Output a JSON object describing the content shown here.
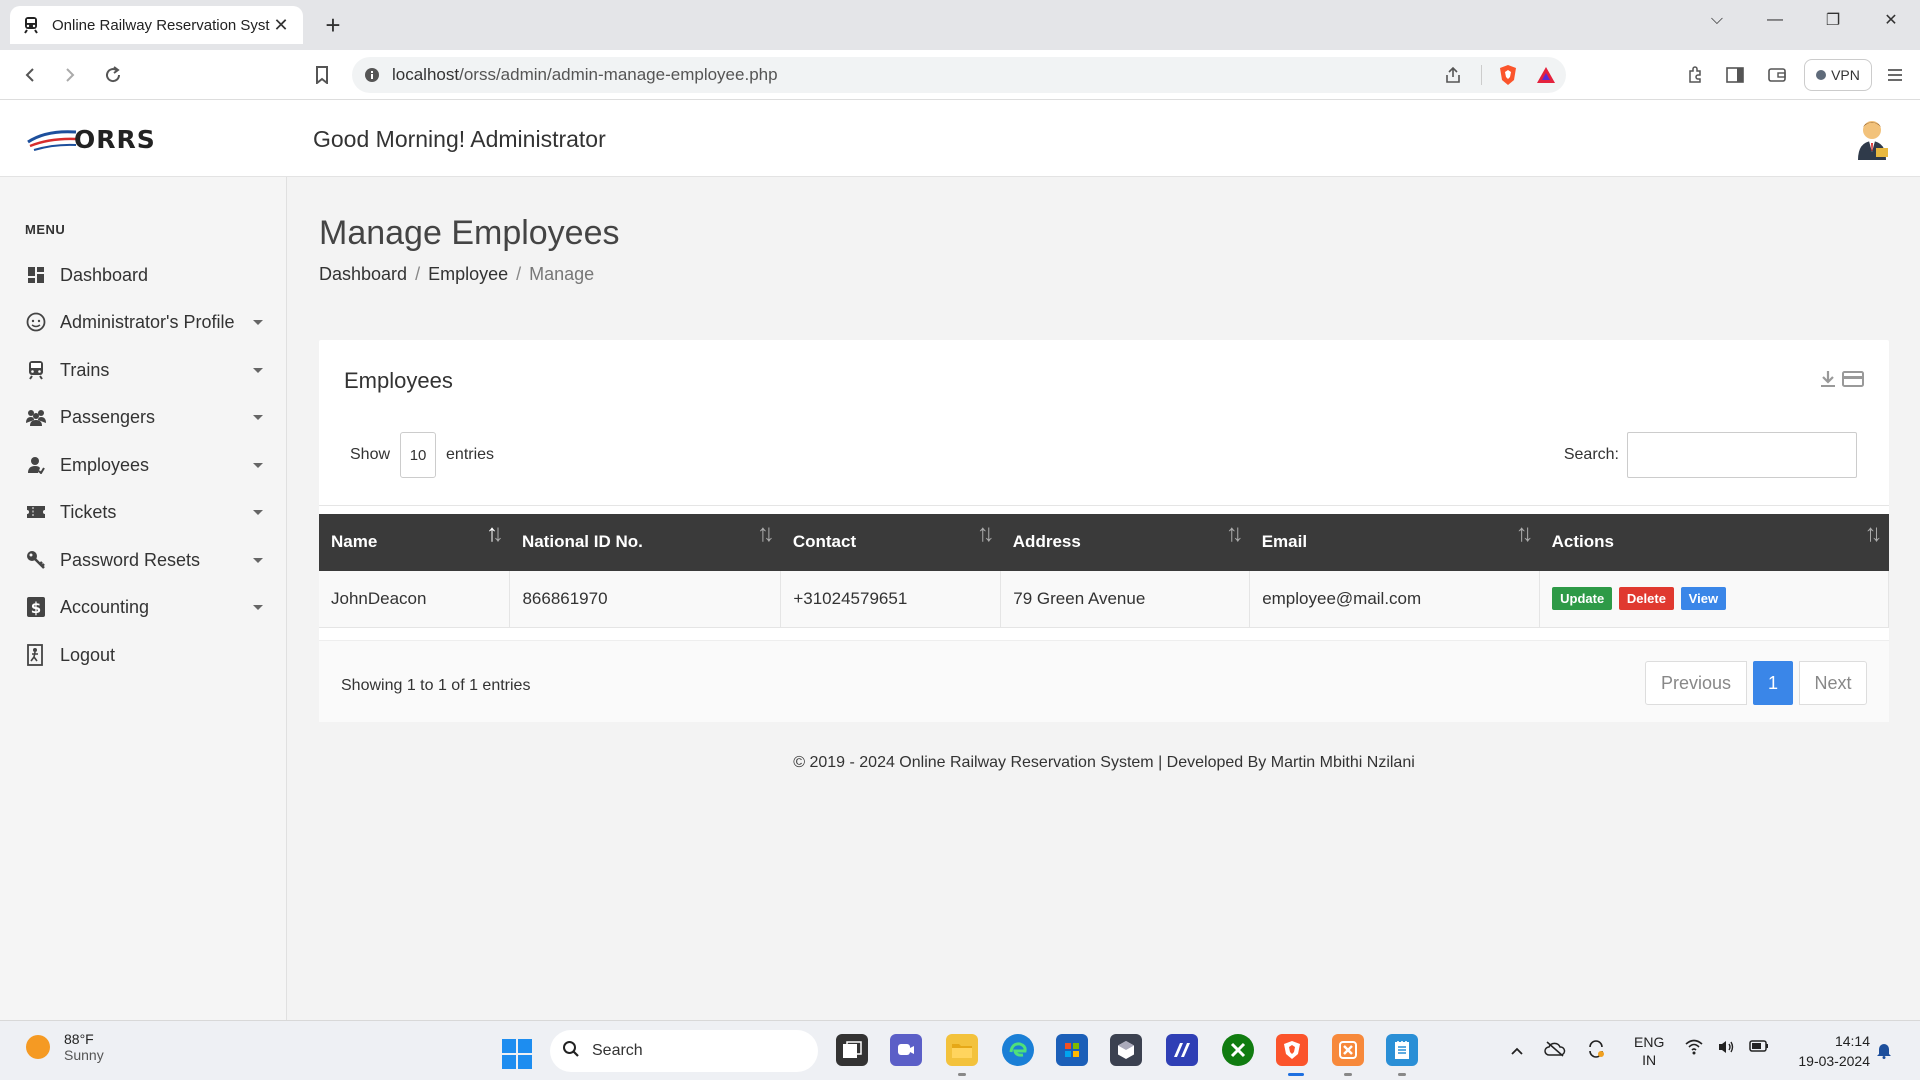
{
  "browser": {
    "tab_title": "Online Railway Reservation Syst",
    "new_tab": "+",
    "url_host": "localhost",
    "url_path": "/orss/admin/admin-manage-employee.php",
    "vpn_label": "VPN"
  },
  "header": {
    "logo_text": "ORRS",
    "greeting": "Good Morning! Administrator"
  },
  "sidebar": {
    "menu_title": "MENU",
    "items": [
      {
        "label": "Dashboard",
        "icon": "dashboard-icon"
      },
      {
        "label": "Administrator's Profile",
        "icon": "profile-icon"
      },
      {
        "label": "Trains",
        "icon": "train-icon"
      },
      {
        "label": "Passengers",
        "icon": "users-icon"
      },
      {
        "label": "Employees",
        "icon": "employee-icon"
      },
      {
        "label": "Tickets",
        "icon": "ticket-icon"
      },
      {
        "label": "Password Resets",
        "icon": "key-icon"
      },
      {
        "label": "Accounting",
        "icon": "dollar-icon"
      },
      {
        "label": "Logout",
        "icon": "logout-icon"
      }
    ]
  },
  "main": {
    "page_title": "Manage Employees",
    "breadcrumb": [
      "Dashboard",
      "Employee",
      "Manage"
    ],
    "breadcrumb_sep": "/",
    "card_title": "Employees",
    "show_label": "Show",
    "entries_value": "10",
    "entries_label": "entries",
    "search_label": "Search:",
    "columns": [
      "Name",
      "National ID No.",
      "Contact",
      "Address",
      "Email",
      "Actions"
    ],
    "rows": [
      {
        "name": "JohnDeacon",
        "national_id": "866861970",
        "contact": "+31024579651",
        "address": "79 Green Avenue",
        "email": "employee@mail.com",
        "actions": [
          "Update",
          "Delete",
          "View"
        ]
      }
    ],
    "info": "Showing 1 to 1 of 1 entries",
    "pager": {
      "previous": "Previous",
      "current": "1",
      "next": "Next"
    },
    "footer": "© 2019 - 2024 Online Railway Reservation System | Developed By Martin Mbithi Nzilani"
  },
  "taskbar": {
    "temp": "88°F",
    "condition": "Sunny",
    "search": "Search",
    "lang1": "ENG",
    "lang2": "IN",
    "time": "14:14",
    "date": "19-03-2024"
  },
  "colors": {
    "accent": "#3a86e8",
    "update": "#2e9a47",
    "delete": "#e0392f",
    "table_header": "#3a3a3a"
  }
}
